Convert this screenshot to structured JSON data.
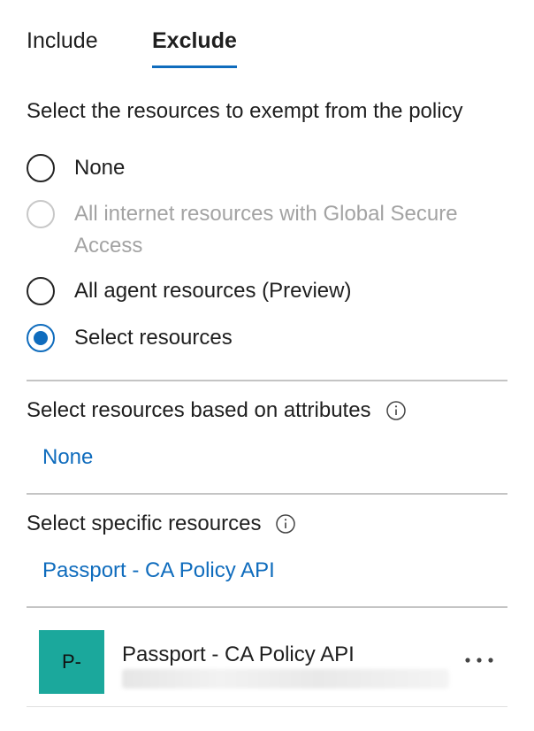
{
  "tabs": [
    {
      "label": "Include",
      "selected": false
    },
    {
      "label": "Exclude",
      "selected": true
    }
  ],
  "accent_color": "#0f6cbd",
  "section_title": "Select the resources to exempt from the policy",
  "radio_options": [
    {
      "label": "None",
      "checked": false,
      "disabled": false
    },
    {
      "label": "All internet resources with Global Secure Access",
      "checked": false,
      "disabled": true
    },
    {
      "label": "All agent resources (Preview)",
      "checked": false,
      "disabled": false
    },
    {
      "label": "Select resources",
      "checked": true,
      "disabled": false
    }
  ],
  "attributes": {
    "label": "Select resources based on attributes",
    "info_icon": "info-icon",
    "value": "None"
  },
  "specific": {
    "label": "Select specific resources",
    "info_icon": "info-icon",
    "value": "Passport - CA Policy API"
  },
  "selected_resource": {
    "avatar_text": "P-",
    "avatar_color": "#1ba89c",
    "name": "Passport - CA Policy API",
    "more_icon": "more-horizontal-icon"
  }
}
